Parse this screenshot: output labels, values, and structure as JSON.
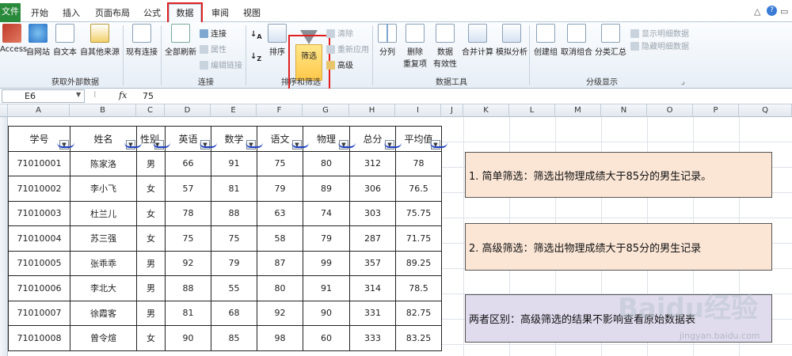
{
  "ribbon_tabs": [
    {
      "label": "文件"
    },
    {
      "label": "开始"
    },
    {
      "label": "插入"
    },
    {
      "label": "页面布局"
    },
    {
      "label": "公式"
    },
    {
      "label": "数据",
      "active": true
    },
    {
      "label": "审阅"
    },
    {
      "label": "视图"
    }
  ],
  "ribbon": {
    "access": "Access",
    "from_web": "自网站",
    "from_text": "自文本",
    "from_other": "自其他来源",
    "existing_conn": "现有连接",
    "group_external": "获取外部数据",
    "refresh_all": "全部刷新",
    "connections": "连接",
    "properties": "属性",
    "edit_links": "编辑链接",
    "group_connections": "连接",
    "sort": "排序",
    "filter": "筛选",
    "clear": "清除",
    "reapply": "重新应用",
    "advanced": "高级",
    "group_sort_filter": "排序和筛选",
    "text_to_columns": "分列",
    "remove_dup_1": "删除",
    "remove_dup_2": "重复项",
    "data_validation_1": "数据",
    "data_validation_2": "有效性",
    "consolidate": "合并计算",
    "what_if": "模拟分析",
    "group_data_tools": "数据工具",
    "group": "创建组",
    "ungroup": "取消组合",
    "subtotal": "分类汇总",
    "show_detail": "显示明细数据",
    "hide_detail": "隐藏明细数据",
    "group_outline": "分级显示"
  },
  "formula_bar": {
    "cell_ref": "E6",
    "fx": "fx",
    "value": "75"
  },
  "columns": [
    "A",
    "B",
    "C",
    "D",
    "E",
    "F",
    "G",
    "H",
    "I",
    "J",
    "K",
    "L",
    "M",
    "N",
    "O",
    "P",
    "Q"
  ],
  "table": {
    "headers": [
      "学号",
      "姓名",
      "性别",
      "英语",
      "数学",
      "语文",
      "物理",
      "总分",
      "平均值"
    ],
    "rows": [
      [
        "71010001",
        "陈家洛",
        "男",
        "66",
        "91",
        "75",
        "80",
        "312",
        "78"
      ],
      [
        "71010002",
        "李小飞",
        "女",
        "57",
        "81",
        "79",
        "89",
        "306",
        "76.5"
      ],
      [
        "71010003",
        "杜兰儿",
        "女",
        "78",
        "88",
        "63",
        "74",
        "303",
        "75.75"
      ],
      [
        "71010004",
        "苏三强",
        "女",
        "75",
        "75",
        "58",
        "79",
        "287",
        "71.75"
      ],
      [
        "71010005",
        "张乖乖",
        "男",
        "92",
        "79",
        "87",
        "99",
        "357",
        "89.25"
      ],
      [
        "71010006",
        "李北大",
        "男",
        "88",
        "55",
        "80",
        "91",
        "314",
        "78.5"
      ],
      [
        "71010007",
        "徐霞客",
        "男",
        "81",
        "68",
        "92",
        "90",
        "331",
        "82.75"
      ],
      [
        "71010008",
        "曾令煊",
        "女",
        "90",
        "85",
        "98",
        "60",
        "333",
        "83.25"
      ]
    ]
  },
  "notes": [
    {
      "text": "1. 简单筛选：筛选出物理成绩大于85分的男生记录。",
      "bg": "#fbe6d6"
    },
    {
      "text": "2. 高级筛选：筛选出物理成绩大于85分的男生记录",
      "bg": "#fbe6d6"
    },
    {
      "text": "两者区别：高级筛选的结果不影响查看原始数据表",
      "bg": "#e0dcee"
    }
  ],
  "watermark": {
    "brand": "Baidu经验",
    "url": "jingyan.baidu.com"
  },
  "colors": {
    "highlight_red": "#e02020",
    "annotation_blue": "#1d3fc2",
    "excel_green": "#2a8a3c"
  }
}
